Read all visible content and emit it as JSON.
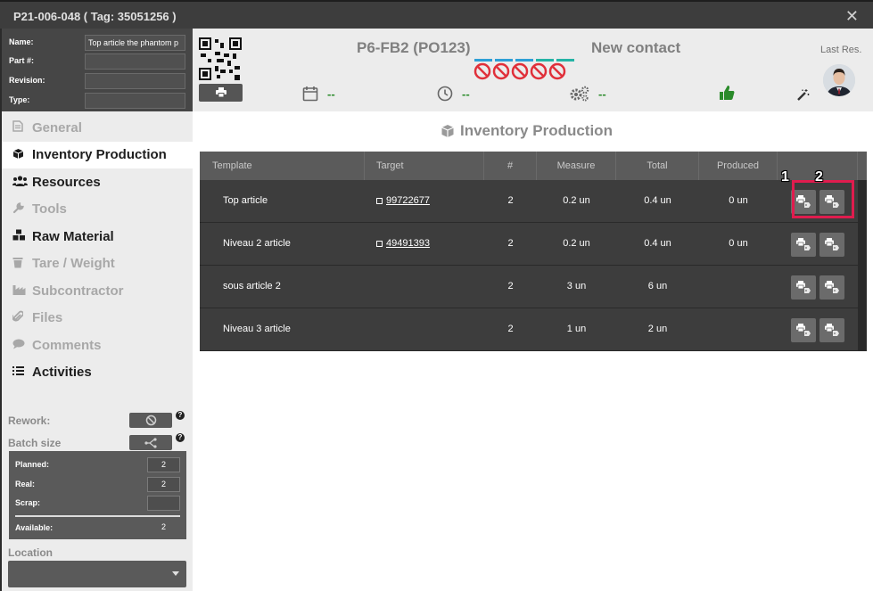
{
  "window": {
    "title": "P21-006-048 ( Tag: 35051256 )",
    "close_label": "✕"
  },
  "part_info": {
    "fields": [
      {
        "label": "Name:",
        "value": "Top article the phantom p"
      },
      {
        "label": "Part #:",
        "value": ""
      },
      {
        "label": "Revision:",
        "value": ""
      },
      {
        "label": "Type:",
        "value": ""
      }
    ]
  },
  "nav": {
    "items": [
      {
        "label": "General",
        "icon": "document-icon",
        "state": "disabled"
      },
      {
        "label": "Inventory Production",
        "icon": "cube-icon",
        "state": "active"
      },
      {
        "label": "Resources",
        "icon": "users-icon",
        "state": "enabled"
      },
      {
        "label": "Tools",
        "icon": "wrench-icon",
        "state": "disabled"
      },
      {
        "label": "Raw Material",
        "icon": "cubes-icon",
        "state": "enabled"
      },
      {
        "label": "Tare / Weight",
        "icon": "trash-icon",
        "state": "disabled"
      },
      {
        "label": "Subcontractor",
        "icon": "industry-icon",
        "state": "disabled"
      },
      {
        "label": "Files",
        "icon": "paperclip-icon",
        "state": "disabled"
      },
      {
        "label": "Comments",
        "icon": "comment-icon",
        "state": "disabled"
      },
      {
        "label": "Activities",
        "icon": "list-icon",
        "state": "enabled"
      }
    ]
  },
  "options": {
    "rework_label": "Rework:",
    "batch_label": "Batch size",
    "help_glyph": "?"
  },
  "quantities": {
    "planned_label": "Planned:",
    "planned": "2",
    "real_label": "Real:",
    "real": "2",
    "scrap_label": "Scrap:",
    "scrap": "",
    "available_label": "Available:",
    "available": "2"
  },
  "location": {
    "label": "Location",
    "value": ""
  },
  "header": {
    "order": "P6-FB2 (PO123)",
    "contact": "New contact",
    "last_res_label": "Last Res.",
    "bar_colors": [
      "#2e9fd6",
      "#2e9fd6",
      "#2e9fd6",
      "#25b3a5",
      "#25b3a5"
    ],
    "stats": [
      {
        "icon": "calendar-icon",
        "value": "--"
      },
      {
        "icon": "clock-icon",
        "value": "--"
      },
      {
        "icon": "gears-icon",
        "value": "--"
      }
    ]
  },
  "colors": {
    "accent_green": "#2a8b2a",
    "no_red": "#e0303a",
    "highlight": "#e01c4e"
  },
  "main": {
    "title": "Inventory Production",
    "columns": [
      "Template",
      "Target",
      "#",
      "Measure",
      "Total",
      "Produced"
    ],
    "rows": [
      {
        "template": "Top article",
        "target": "99722677",
        "count": "2",
        "measure": "0.2 un",
        "total": "0.4 un",
        "produced": "0 un"
      },
      {
        "template": "Niveau 2 article",
        "target": "49491393",
        "count": "2",
        "measure": "0.2 un",
        "total": "0.4 un",
        "produced": "0 un"
      },
      {
        "template": "sous article 2",
        "target": "",
        "count": "2",
        "measure": "3 un",
        "total": "6 un",
        "produced": ""
      },
      {
        "template": "Niveau 3 article",
        "target": "",
        "count": "2",
        "measure": "1 un",
        "total": "2 un",
        "produced": ""
      }
    ],
    "markers": [
      "1",
      "2"
    ]
  }
}
